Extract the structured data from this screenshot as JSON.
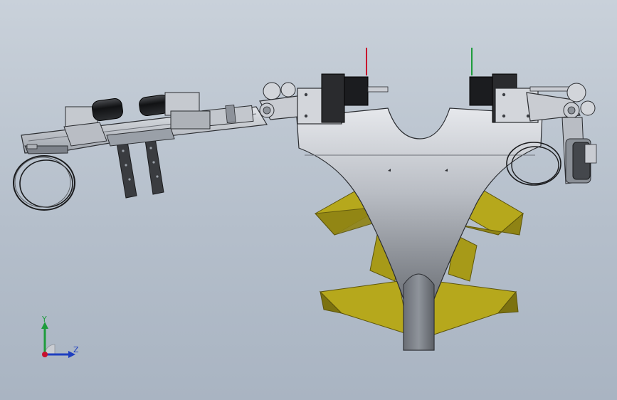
{
  "viewport": {
    "background_top": "#c9d1da",
    "background_bottom": "#a9b4c2"
  },
  "model": {
    "colors": {
      "metal_light": "#d4d8de",
      "metal_mid": "#9aa0a8",
      "metal_dark": "#3c3f44",
      "motor_black": "#1b1c1f",
      "cuff_yellow": "#b6a81c",
      "cuff_yellow_dark": "#7c7210",
      "z_axis_red": "#c8102e",
      "y_axis_green": "#1e9c3c"
    },
    "parts": [
      "hip-frame",
      "thigh-link-left",
      "hip-motor-left",
      "hip-motor-right",
      "thigh-link-right",
      "strap-plates",
      "leg-cuff-rings",
      "torso-harness",
      "waist-straps",
      "cable-spool"
    ]
  },
  "triad": {
    "y_label": "Y",
    "z_label": "Z",
    "colors": {
      "y": "#1e9c3c",
      "z": "#1f3fbf",
      "origin": "#c8102e"
    }
  }
}
